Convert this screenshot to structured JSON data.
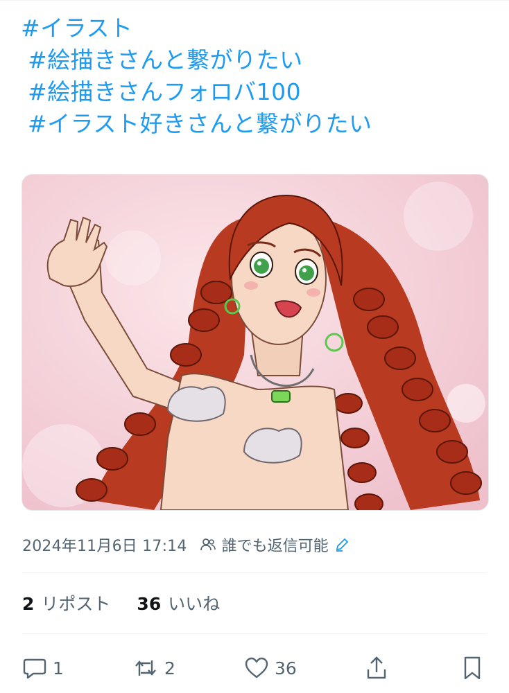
{
  "tweet": {
    "hashtags": [
      "#イラスト",
      "#絵描きさんと繋がりたい",
      "#絵描きさんフォロバ100",
      "#イラスト好きさんと繋がりたい"
    ],
    "image_alt": "",
    "timestamp": "2024年11月6日 17:14",
    "reply_setting": "誰でも返信可能"
  },
  "stats": {
    "reposts_count": "2",
    "reposts_label": "リポスト",
    "likes_count": "36",
    "likes_label": "いいね"
  },
  "actions": {
    "reply_count": "1",
    "repost_count": "2",
    "like_count": "36"
  },
  "colors": {
    "link": "#1d9bf0",
    "secondary_text": "#536471",
    "primary_text": "#0f1419",
    "divider": "#eff3f4"
  },
  "icons": [
    "people-icon",
    "pen-icon",
    "reply-icon",
    "repost-icon",
    "like-icon",
    "share-icon",
    "bookmark-icon"
  ]
}
